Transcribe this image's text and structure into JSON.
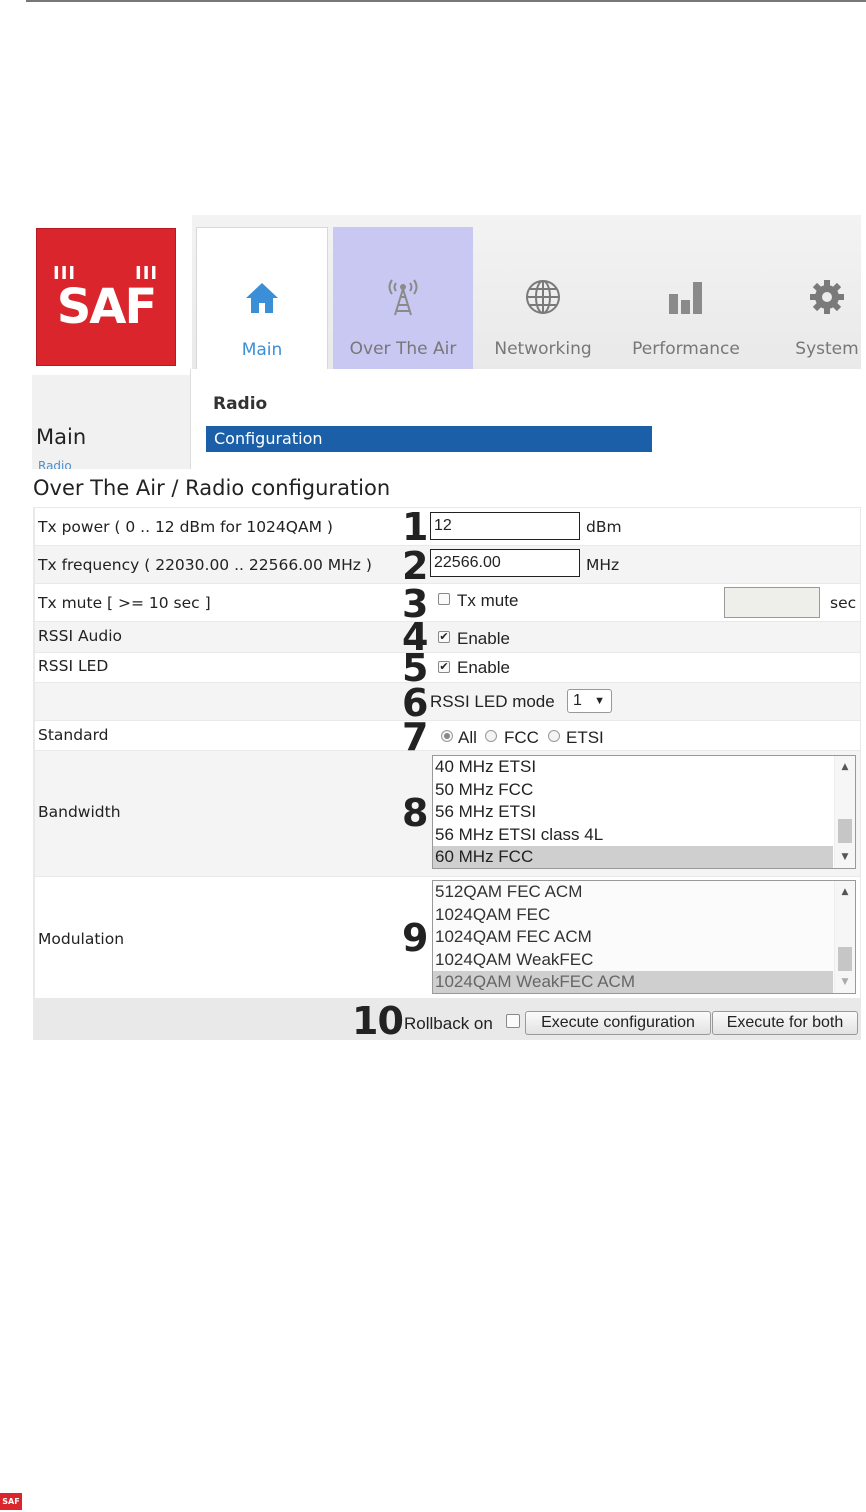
{
  "header": {
    "logo_text": "SAF",
    "tabs": [
      {
        "label": "Main",
        "icon": "home-icon"
      },
      {
        "label": "Over The Air",
        "icon": "antenna-icon"
      },
      {
        "label": "Networking",
        "icon": "globe-icon"
      },
      {
        "label": "Performance",
        "icon": "bar-chart-icon"
      },
      {
        "label": "System",
        "icon": "gear-icon"
      }
    ],
    "active_tab_color": "#3b8fd6",
    "selected_tab_bg": "#c9c8f3"
  },
  "sidebar": {
    "title": "Main",
    "item": "Radio"
  },
  "submenu": {
    "heading": "Radio",
    "item": "Configuration",
    "item_bg": "#1a5fa8"
  },
  "page_title": "Over The Air / Radio configuration",
  "form": {
    "tx_power": {
      "label": "Tx power  ( 0 .. 12 dBm  for 1024QAM )",
      "marker": "1",
      "value": "12",
      "unit": "dBm"
    },
    "tx_frequency": {
      "label": "Tx frequency  ( 22030.00 .. 22566.00 MHz )",
      "marker": "2",
      "value": "22566.00",
      "unit": "MHz"
    },
    "tx_mute": {
      "label": "Tx mute [ >= 10 sec ]",
      "marker": "3",
      "checkbox_label": "Tx mute",
      "checked": false,
      "seconds_value": "",
      "seconds_unit": "sec"
    },
    "rssi_audio": {
      "label": "RSSI Audio",
      "marker": "4",
      "checkbox_label": "Enable",
      "checked": true
    },
    "rssi_led": {
      "label": "RSSI LED",
      "marker": "5",
      "checkbox_label": "Enable",
      "checked": true
    },
    "rssi_led_mode": {
      "marker": "6",
      "label": "RSSI LED mode",
      "value": "1"
    },
    "standard": {
      "label": "Standard",
      "marker": "7",
      "options": [
        "All",
        "FCC",
        "ETSI"
      ],
      "selected": "All"
    },
    "bandwidth": {
      "label": "Bandwidth",
      "marker": "8",
      "options": [
        "40 MHz ETSI",
        "50 MHz FCC",
        "56 MHz ETSI",
        "56 MHz ETSI class 4L",
        "60 MHz FCC"
      ],
      "selected": "60 MHz FCC"
    },
    "modulation": {
      "label": "Modulation",
      "marker": "9",
      "options": [
        "512QAM FEC ACM",
        "1024QAM FEC",
        "1024QAM FEC ACM",
        "1024QAM WeakFEC",
        "1024QAM WeakFEC ACM"
      ],
      "selected": "1024QAM WeakFEC ACM"
    },
    "footer": {
      "marker": "10",
      "rollback_label": "Rollback on",
      "rollback_checked": false,
      "execute_label": "Execute configuration",
      "execute_both_label": "Execute for both"
    }
  },
  "page_footer_logo": "SAF"
}
